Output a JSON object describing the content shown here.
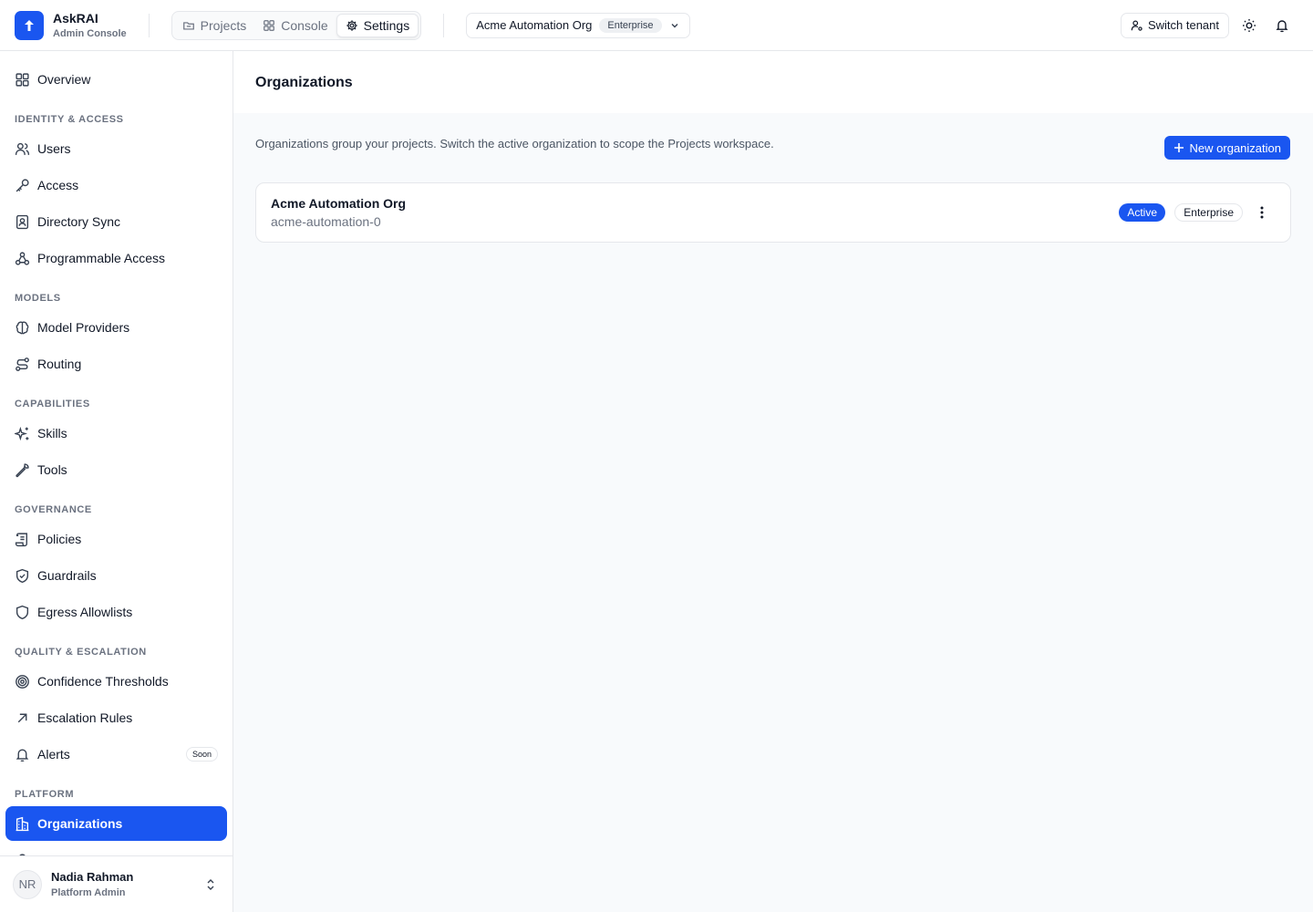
{
  "app": {
    "name": "AskRAI",
    "subtitle": "Admin Console"
  },
  "header": {
    "tabs": [
      {
        "label": "Projects",
        "icon": "folder-icon"
      },
      {
        "label": "Console",
        "icon": "grid-icon"
      },
      {
        "label": "Settings",
        "icon": "gear-icon",
        "active": true
      }
    ],
    "org_switcher": {
      "name": "Acme Automation Org",
      "tier": "Enterprise"
    },
    "switch_tenant_label": "Switch tenant"
  },
  "sidebar": {
    "overview": "Overview",
    "sections": {
      "identity": "IDENTITY & ACCESS",
      "models": "MODELS",
      "capabilities": "CAPABILITIES",
      "governance": "GOVERNANCE",
      "quality": "QUALITY & ESCALATION",
      "platform": "PLATFORM"
    },
    "items": {
      "users": "Users",
      "access": "Access",
      "directory_sync": "Directory Sync",
      "programmable_access": "Programmable Access",
      "model_providers": "Model Providers",
      "routing": "Routing",
      "skills": "Skills",
      "tools": "Tools",
      "policies": "Policies",
      "guardrails": "Guardrails",
      "egress_allowlists": "Egress Allowlists",
      "confidence_thresholds": "Confidence Thresholds",
      "escalation_rules": "Escalation Rules",
      "alerts": "Alerts",
      "organizations": "Organizations"
    },
    "alerts_badge": "Soon",
    "active_item": "Organizations"
  },
  "user": {
    "initials": "NR",
    "name": "Nadia Rahman",
    "role": "Platform Admin"
  },
  "main": {
    "title": "Organizations",
    "description": "Organizations group your projects. Switch the active organization to scope the Projects workspace.",
    "new_button": "New organization",
    "orgs": [
      {
        "name": "Acme Automation Org",
        "slug": "acme-automation-0",
        "status": "Active",
        "tier": "Enterprise"
      }
    ]
  },
  "colors": {
    "accent": "#1a56f0",
    "border": "#e5e7eb",
    "muted": "#6b7280",
    "background": "#f8fafc"
  }
}
